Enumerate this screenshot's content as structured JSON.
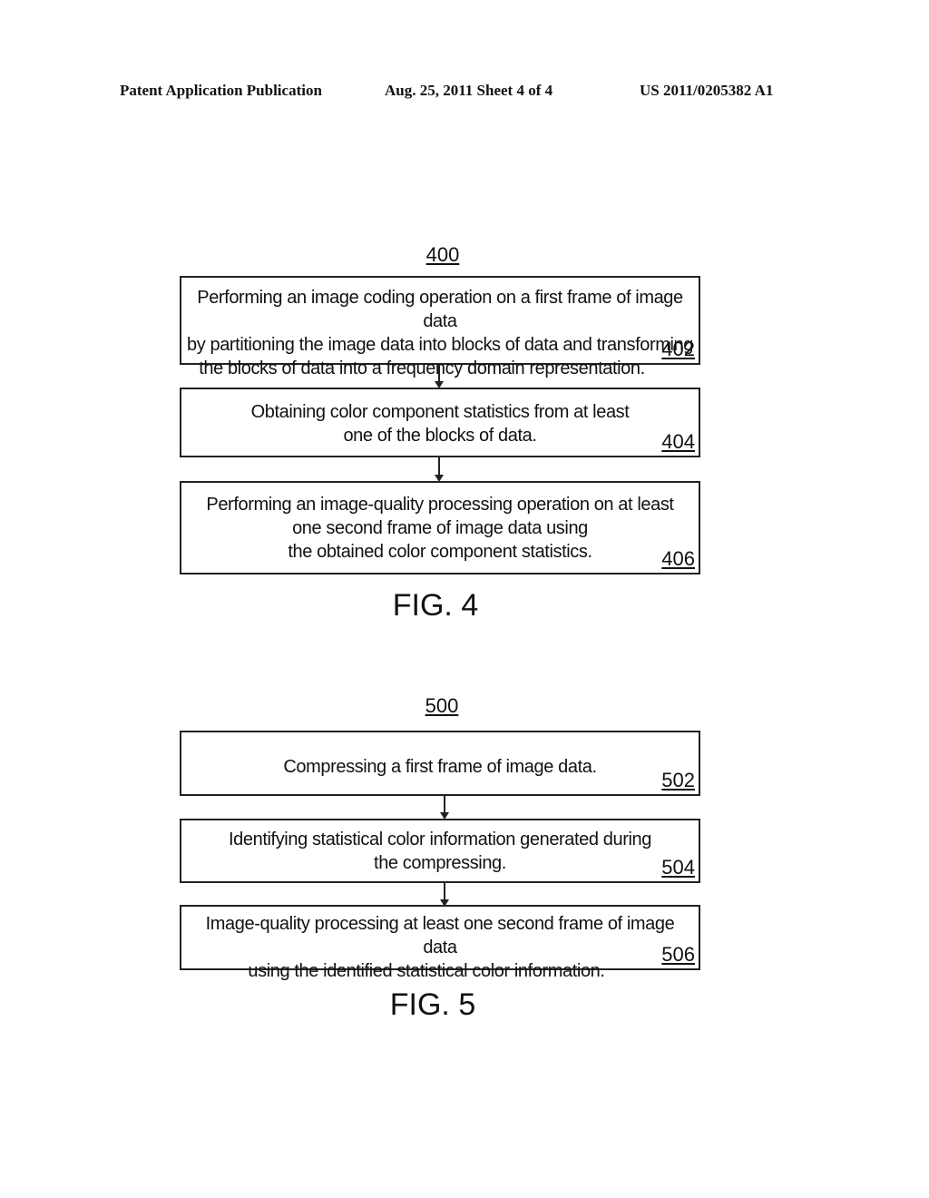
{
  "header": {
    "publication": "Patent Application Publication",
    "date_sheet": "Aug. 25, 2011  Sheet 4 of 4",
    "patent_number": "US 2011/0205382 A1"
  },
  "fig4": {
    "number": "400",
    "label": "FIG. 4",
    "steps": [
      {
        "lines": [
          "Performing an image coding operation on a first frame of image data",
          "by partitioning the image data into blocks of data and transforming",
          "the blocks of data into a frequency domain representation."
        ],
        "ref": "402"
      },
      {
        "lines": [
          "Obtaining color component statistics from at least",
          "one of the blocks of data."
        ],
        "ref": "404"
      },
      {
        "lines": [
          "Performing an image-quality processing operation on at least",
          "one second frame of image data using",
          "the obtained color component statistics."
        ],
        "ref": "406"
      }
    ]
  },
  "fig5": {
    "number": "500",
    "label": "FIG. 5",
    "steps": [
      {
        "lines": [
          "Compressing a first frame of image data."
        ],
        "ref": "502"
      },
      {
        "lines": [
          "Identifying statistical color information generated during",
          "the compressing."
        ],
        "ref": "504"
      },
      {
        "lines": [
          "Image-quality processing at least one second frame of image data",
          "using the identified statistical color information."
        ],
        "ref": "506"
      }
    ]
  }
}
